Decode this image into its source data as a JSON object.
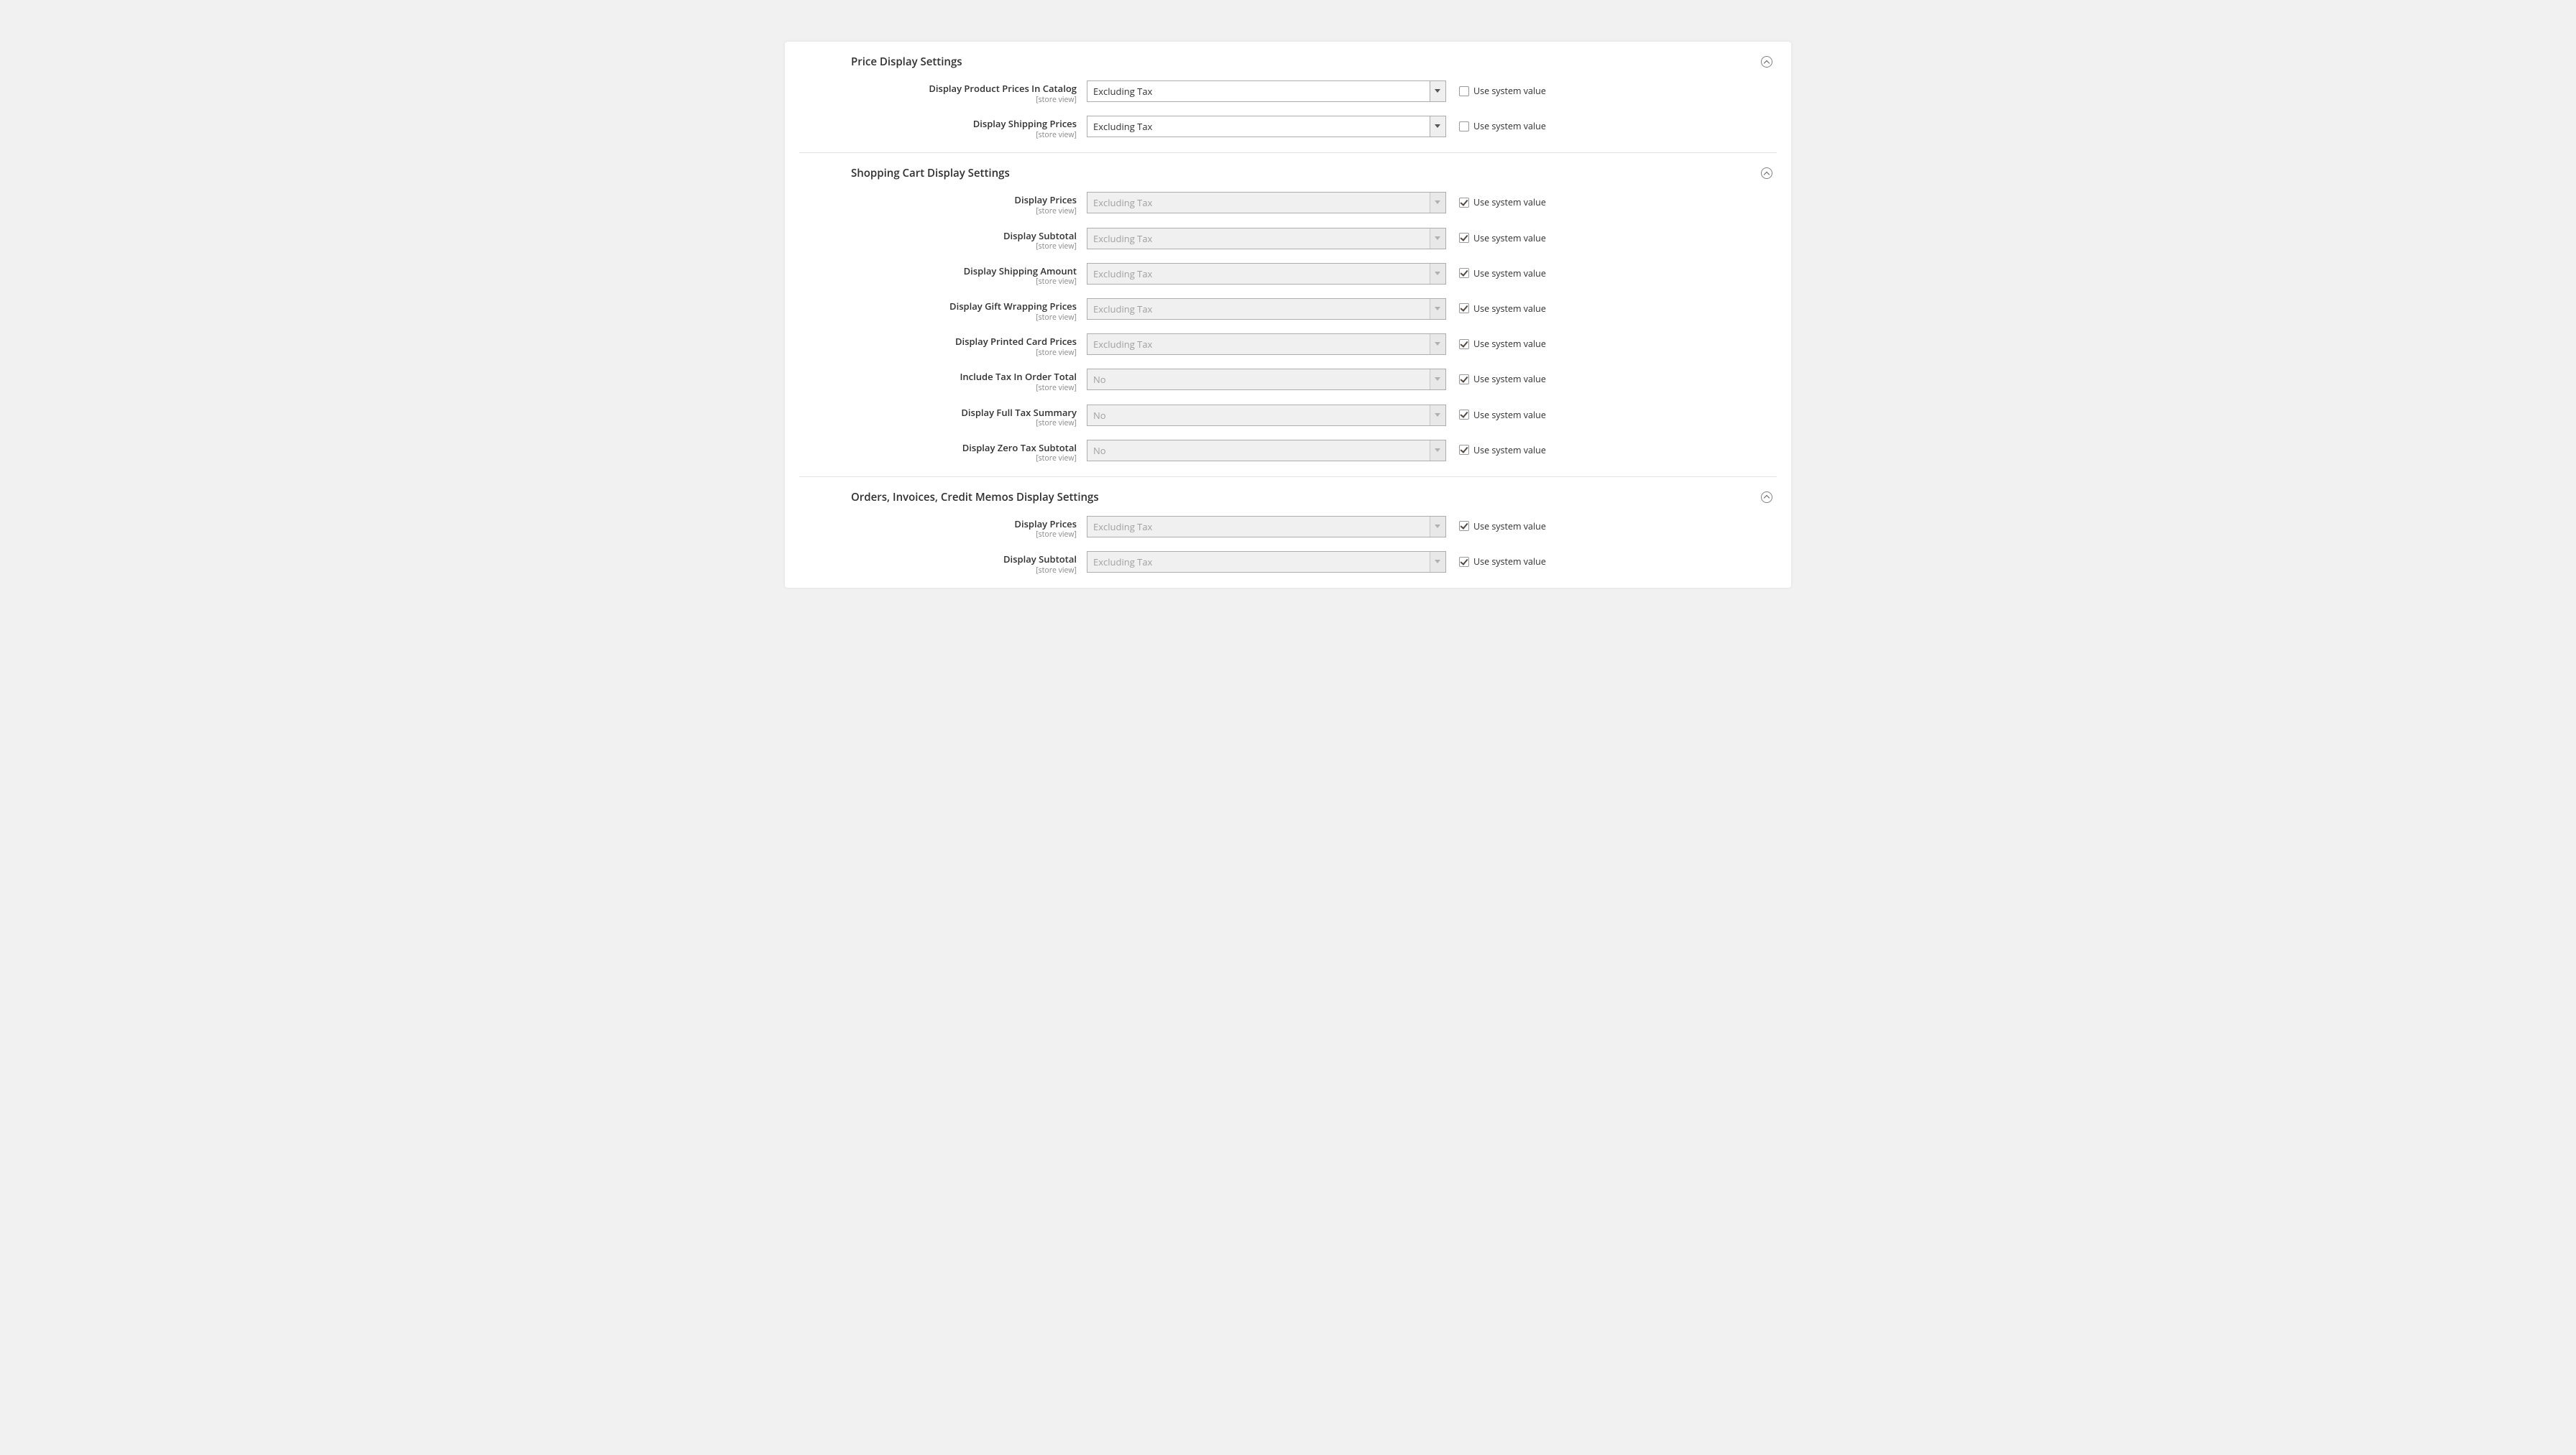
{
  "common": {
    "scope_label": "[store view]",
    "use_system_label": "Use system value"
  },
  "sections": [
    {
      "id": "price-display",
      "title": "Price Display Settings",
      "fields": [
        {
          "id": "catalog-prices",
          "label": "Display Product Prices In Catalog",
          "value": "Excluding Tax",
          "disabled": false,
          "use_system": false
        },
        {
          "id": "shipping-prices",
          "label": "Display Shipping Prices",
          "value": "Excluding Tax",
          "disabled": false,
          "use_system": false
        }
      ]
    },
    {
      "id": "cart-display",
      "title": "Shopping Cart Display Settings",
      "fields": [
        {
          "id": "cart-prices",
          "label": "Display Prices",
          "value": "Excluding Tax",
          "disabled": true,
          "use_system": true
        },
        {
          "id": "cart-subtotal",
          "label": "Display Subtotal",
          "value": "Excluding Tax",
          "disabled": true,
          "use_system": true
        },
        {
          "id": "cart-shipping-amt",
          "label": "Display Shipping Amount",
          "value": "Excluding Tax",
          "disabled": true,
          "use_system": true
        },
        {
          "id": "cart-giftwrap",
          "label": "Display Gift Wrapping Prices",
          "value": "Excluding Tax",
          "disabled": true,
          "use_system": true
        },
        {
          "id": "cart-printed-card",
          "label": "Display Printed Card Prices",
          "value": "Excluding Tax",
          "disabled": true,
          "use_system": true
        },
        {
          "id": "cart-include-tax",
          "label": "Include Tax In Order Total",
          "value": "No",
          "disabled": true,
          "use_system": true
        },
        {
          "id": "cart-full-summary",
          "label": "Display Full Tax Summary",
          "value": "No",
          "disabled": true,
          "use_system": true
        },
        {
          "id": "cart-zero-subtotal",
          "label": "Display Zero Tax Subtotal",
          "value": "No",
          "disabled": true,
          "use_system": true
        }
      ]
    },
    {
      "id": "orders-display",
      "title": "Orders, Invoices, Credit Memos Display Settings",
      "fields": [
        {
          "id": "order-prices",
          "label": "Display Prices",
          "value": "Excluding Tax",
          "disabled": true,
          "use_system": true
        },
        {
          "id": "order-subtotal",
          "label": "Display Subtotal",
          "value": "Excluding Tax",
          "disabled": true,
          "use_system": true
        }
      ]
    }
  ]
}
